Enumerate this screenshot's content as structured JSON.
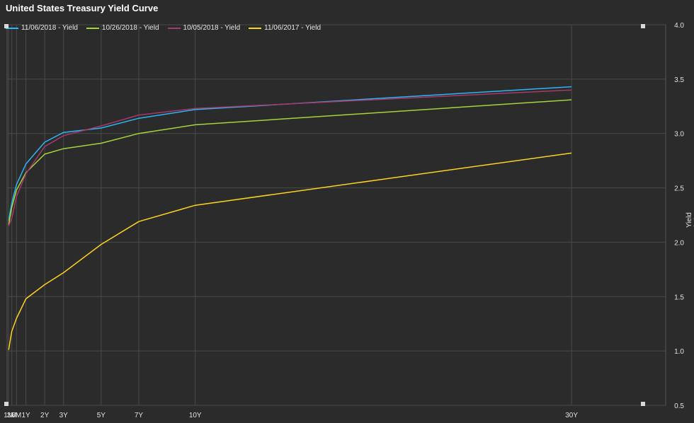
{
  "chart_data": {
    "type": "line",
    "title": "United States Treasury Yield Curve",
    "xlabel": "",
    "ylabel": "Yield (%)",
    "categories": [
      "1M",
      "3M",
      "6M",
      "1Y",
      "2Y",
      "3Y",
      "5Y",
      "7Y",
      "10Y",
      "30Y"
    ],
    "maturity_years": [
      0.0833,
      0.25,
      0.5,
      1,
      2,
      3,
      5,
      7,
      10,
      30
    ],
    "ylim": [
      0.5,
      4.0
    ],
    "yticks": [
      "4.0",
      "3.5",
      "3.0",
      "2.5",
      "2.0",
      "1.5",
      "1.0",
      "0.5"
    ],
    "grid": true,
    "legend_position": "top-left",
    "series": [
      {
        "name": "11/06/2018 - Yield",
        "color": "#29b6f6",
        "values": [
          2.2,
          2.36,
          2.53,
          2.72,
          2.92,
          3.01,
          3.05,
          3.14,
          3.22,
          3.43
        ]
      },
      {
        "name": "10/26/2018 - Yield",
        "color": "#a4d63a",
        "values": [
          2.16,
          2.32,
          2.48,
          2.64,
          2.81,
          2.86,
          2.91,
          3.0,
          3.08,
          3.31
        ]
      },
      {
        "name": "10/05/2018 - Yield",
        "color": "#a8386a",
        "values": [
          2.15,
          2.22,
          2.42,
          2.63,
          2.88,
          2.98,
          3.07,
          3.17,
          3.23,
          3.4
        ]
      },
      {
        "name": "11/06/2017 - Yield",
        "color": "#ffd21f",
        "values": [
          1.01,
          1.18,
          1.3,
          1.48,
          1.61,
          1.72,
          1.98,
          2.19,
          2.34,
          2.82
        ]
      }
    ]
  }
}
